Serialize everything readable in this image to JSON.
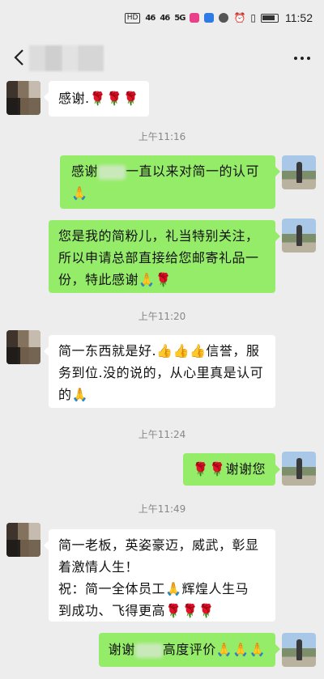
{
  "status_bar": {
    "badges": [
      "HD",
      "46",
      "46",
      "5G"
    ],
    "time": "11:52"
  },
  "icons": {
    "back": "chevron-left-icon",
    "more": "more-dots-icon",
    "rose": "🌹",
    "hands": "🙏",
    "thumb": "👍"
  },
  "colors": {
    "chat_bg": "#ededed",
    "sent_bubble": "#95ec69",
    "received_bubble": "#ffffff"
  },
  "messages": [
    {
      "side": "left",
      "parts": [
        "感谢."
      ],
      "emoji_after": "🌹🌹🌹"
    },
    {
      "timestamp": "上午11:16"
    },
    {
      "side": "right",
      "line1_before": "感谢",
      "line1_after": "一直以来对简一的认可",
      "line2_emoji": "🙏"
    },
    {
      "side": "right",
      "lines": [
        "您是我的简粉儿，礼当特别关注，",
        "所以申请总部直接给您邮寄礼品一",
        "份，特此感谢"
      ],
      "emoji_after": "🙏🌹"
    },
    {
      "timestamp": "上午11:20"
    },
    {
      "side": "left",
      "line1_before": "简一东西就是好.",
      "thumbs": "👍👍👍",
      "line1_after": "信誉，服",
      "line2": "务到位.没的说的，从心里真是认可",
      "line3": "的",
      "emoji_after": "🙏"
    },
    {
      "timestamp": "上午11:24"
    },
    {
      "side": "right",
      "emoji_before": "🌹🌹",
      "text": "谢谢您"
    },
    {
      "timestamp": "上午11:49"
    },
    {
      "side": "left",
      "lines": [
        "简一老板，英姿豪迈，威武，彰显",
        "着激情人生！",
        "祝：简一全体员工"
      ],
      "line3_emoji": "🙏",
      "line3_after": "辉煌人生马",
      "line4": "到成功、飞得更高",
      "line4_emoji": "🌹🌹🌹"
    },
    {
      "side": "right",
      "before": "谢谢",
      "after": "高度评价",
      "emoji_after": "🙏🙏🙏"
    }
  ]
}
